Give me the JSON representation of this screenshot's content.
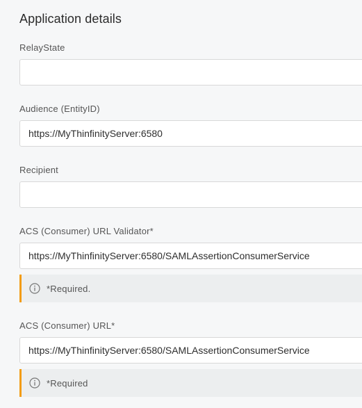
{
  "section": {
    "title": "Application details"
  },
  "fields": {
    "relay_state": {
      "label": "RelayState",
      "value": ""
    },
    "audience": {
      "label": "Audience (EntityID)",
      "value": "https://MyThinfinityServer:6580"
    },
    "recipient": {
      "label": "Recipient",
      "value": ""
    },
    "acs_validator": {
      "label": "ACS (Consumer) URL Validator*",
      "value": "https://MyThinfinityServer:6580/SAMLAssertionConsumerService",
      "notice": "*Required."
    },
    "acs_url": {
      "label": "ACS (Consumer) URL*",
      "value": "https://MyThinfinityServer:6580/SAMLAssertionConsumerService",
      "notice": "*Required"
    }
  },
  "icons": {
    "notice_icon": "info-circle-icon"
  },
  "colors": {
    "background": "#f6f7f8",
    "notice_accent": "#f39c12",
    "notice_background": "#eceeef"
  }
}
